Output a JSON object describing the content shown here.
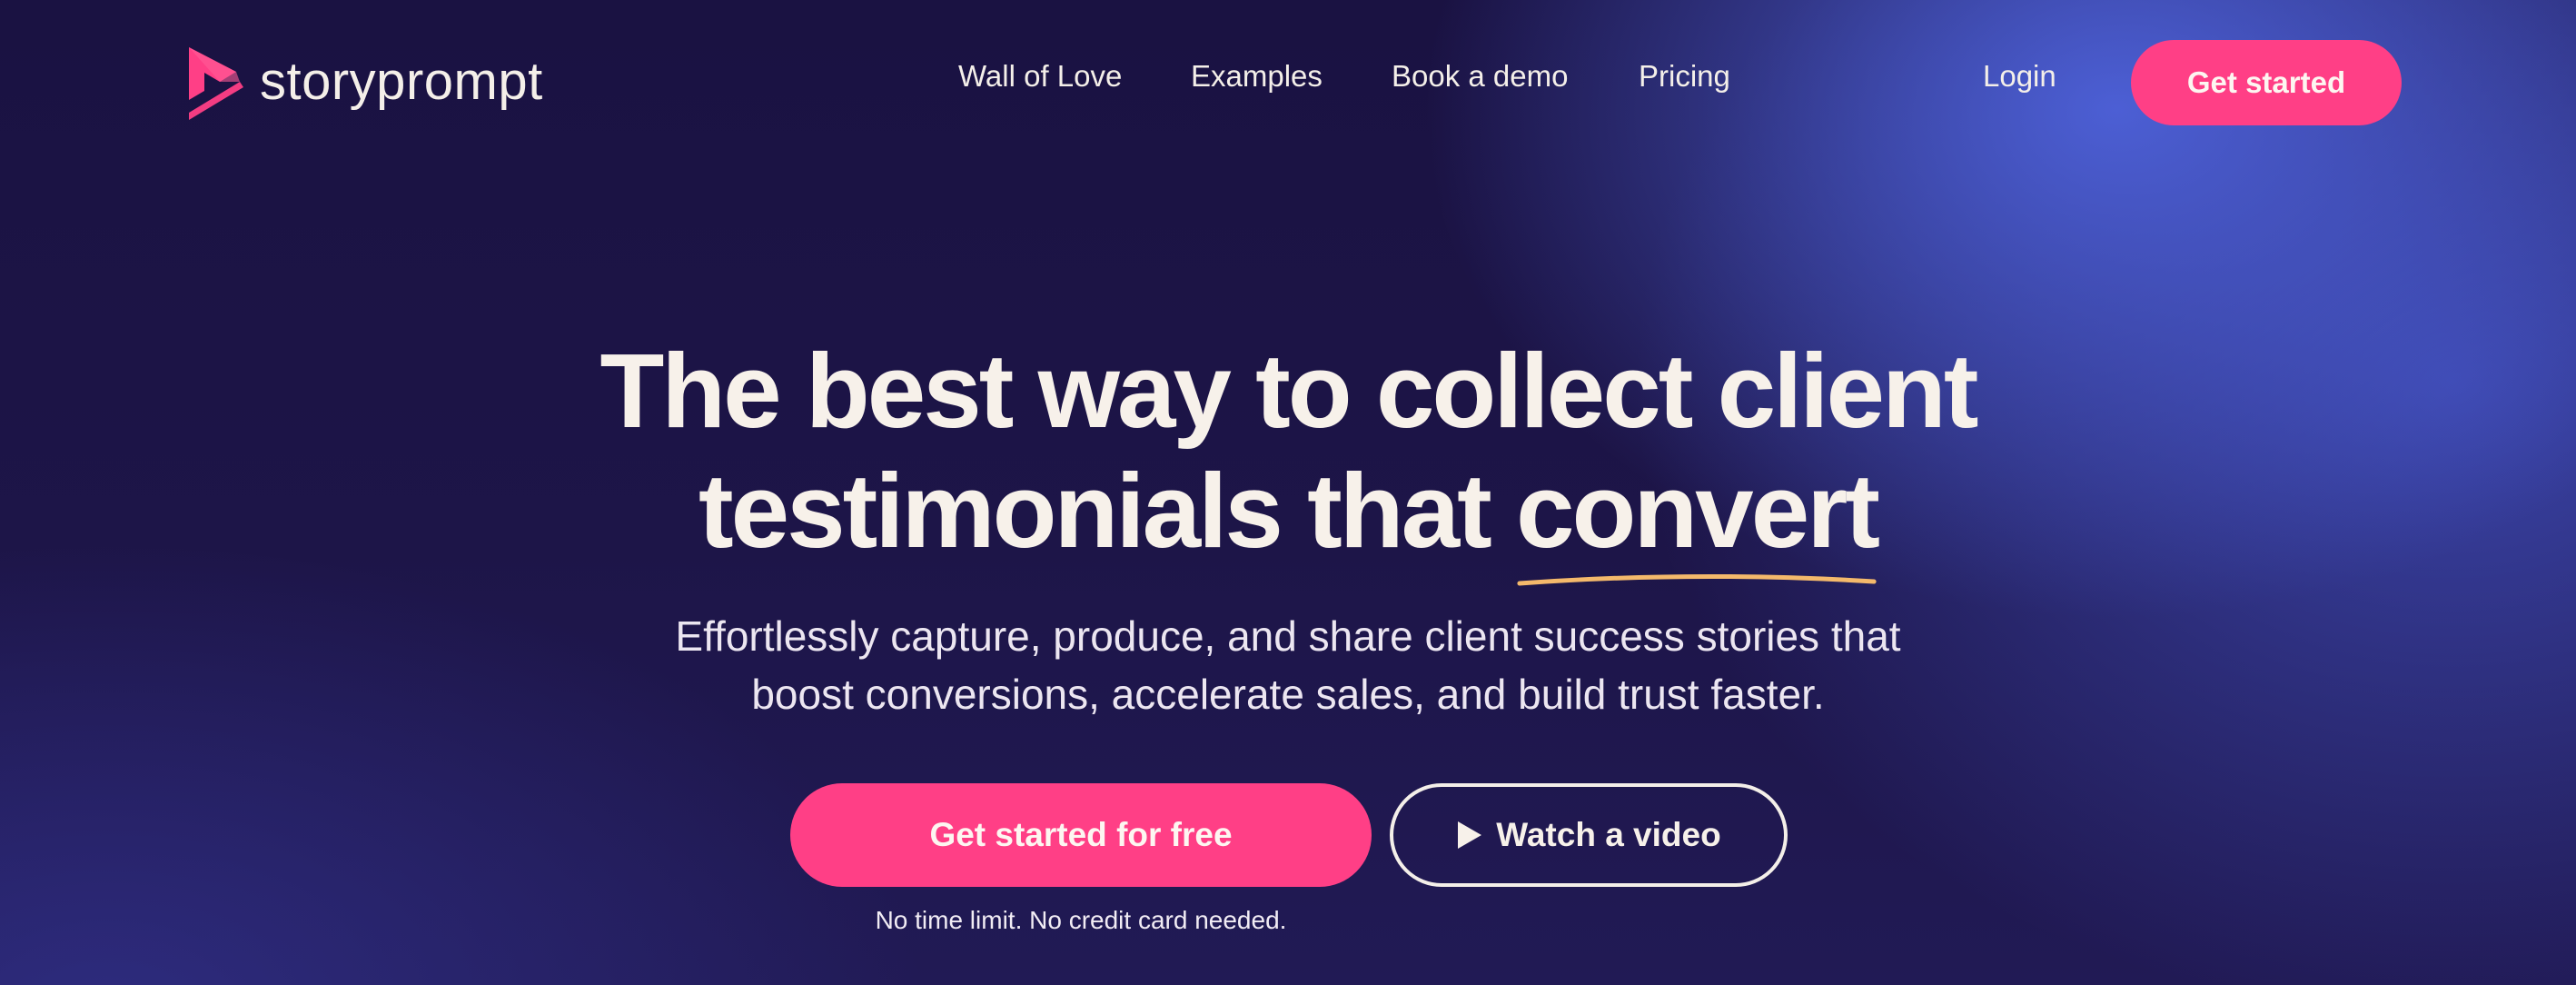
{
  "brand": {
    "name": "storyprompt",
    "logo_icon": "storyprompt-play-logo-icon",
    "accent_color": "#ff3f86"
  },
  "nav": {
    "items": [
      {
        "label": "Wall of Love"
      },
      {
        "label": "Examples"
      },
      {
        "label": "Book a demo"
      },
      {
        "label": "Pricing"
      }
    ],
    "login_label": "Login",
    "cta_label": "Get started"
  },
  "hero": {
    "title_line1": "The best way to collect client",
    "title_line2_prefix": "testimonials that ",
    "title_highlight": "convert",
    "highlight_underline_color": "#f4b96b",
    "subtitle_line1": "Effortlessly capture, produce, and share client success stories that",
    "subtitle_line2": "boost conversions, accelerate sales, and build trust faster.",
    "primary_cta_label": "Get started for free",
    "video_cta_label": "Watch a video",
    "video_cta_icon": "play-icon",
    "note": "No time limit. No credit card needed."
  }
}
